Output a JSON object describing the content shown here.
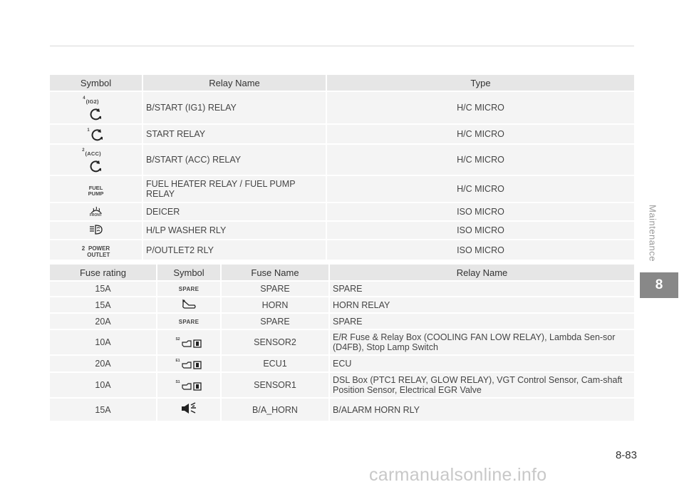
{
  "relay_table": {
    "headers": [
      "Symbol",
      "Relay Name",
      "Type"
    ],
    "rows": [
      {
        "symbol": {
          "sup": "4",
          "text": "(IG2)",
          "icon": "ignition-key-icon"
        },
        "name": "B/START (IG1) RELAY",
        "type": "H/C MICRO"
      },
      {
        "symbol": {
          "sup": "1",
          "text": "",
          "icon": "ignition-key-icon"
        },
        "name": "START RELAY",
        "type": "H/C MICRO"
      },
      {
        "symbol": {
          "sup": "2",
          "text": "(ACC)",
          "icon": "ignition-key-icon"
        },
        "name": "B/START (ACC) RELAY",
        "type": "H/C MICRO"
      },
      {
        "symbol": {
          "line1": "FUEL",
          "line2": "PUMP"
        },
        "name": "FUEL HEATER RELAY / FUEL PUMP RELAY",
        "type": "H/C MICRO"
      },
      {
        "symbol": {
          "text": "FRONT",
          "icon": "front-defroster-icon"
        },
        "name": "DEICER",
        "type": "ISO MICRO"
      },
      {
        "symbol": {
          "icon": "headlamp-washer-icon"
        },
        "name": "H/LP WASHER RLY",
        "type": "ISO MICRO"
      },
      {
        "symbol": {
          "sup": "2",
          "line1": "POWER",
          "line2": "OUTLET"
        },
        "name": "P/OUTLET2 RLY",
        "type": "ISO MICRO"
      }
    ]
  },
  "fuse_table": {
    "headers": [
      "Fuse rating",
      "Symbol",
      "Fuse Name",
      "Relay Name"
    ],
    "rows": [
      {
        "rating": "15A",
        "symbol": {
          "text": "SPARE"
        },
        "fuse": "SPARE",
        "relay": "SPARE"
      },
      {
        "rating": "15A",
        "symbol": {
          "icon": "horn-icon"
        },
        "fuse": "HORN",
        "relay": "HORN RELAY"
      },
      {
        "rating": "20A",
        "symbol": {
          "text": "SPARE"
        },
        "fuse": "SPARE",
        "relay": "SPARE"
      },
      {
        "rating": "10A",
        "symbol": {
          "sup": "S2",
          "icon": "engine-sensor-icon"
        },
        "fuse": "SENSOR2",
        "relay": "E/R Fuse & Relay Box (COOLING FAN LOW RELAY), Lambda Sen-sor (D4FB), Stop Lamp Switch"
      },
      {
        "rating": "20A",
        "symbol": {
          "sup": "E1",
          "icon": "engine-sensor-icon"
        },
        "fuse": "ECU1",
        "relay": "ECU"
      },
      {
        "rating": "10A",
        "symbol": {
          "sup": "S1",
          "icon": "engine-sensor-icon"
        },
        "fuse": "SENSOR1",
        "relay": "DSL Box (PTC1 RELAY, GLOW RELAY), VGT Control Sensor, Cam-shaft Position Sensor, Electrical EGR Valve"
      },
      {
        "rating": "15A",
        "symbol": {
          "icon": "alarm-horn-icon"
        },
        "fuse": "B/A_HORN",
        "relay": "B/ALARM HORN RLY"
      }
    ]
  },
  "side_label": "Maintenance",
  "chapter": "8",
  "page_number": "8-83",
  "watermark": "carmanualsonline.info"
}
